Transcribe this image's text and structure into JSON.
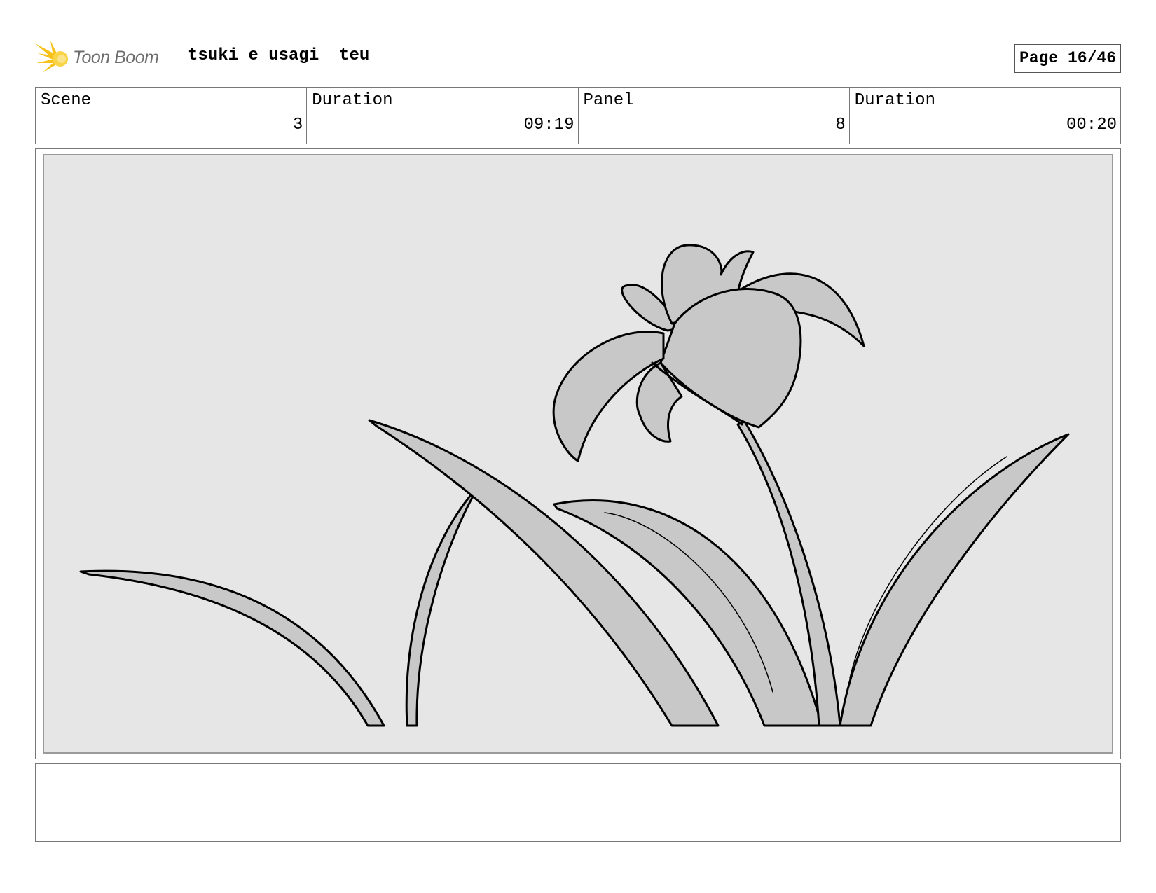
{
  "header": {
    "logo_text": "Toon Boom",
    "project_title": "tsuki e usagi  teu",
    "page_label": "Page 16/46"
  },
  "info": {
    "scene": {
      "label": "Scene",
      "value": "3"
    },
    "scene_duration": {
      "label": "Duration",
      "value": "09:19"
    },
    "panel": {
      "label": "Panel",
      "value": "8"
    },
    "panel_duration": {
      "label": "Duration",
      "value": "00:20"
    }
  },
  "notes": {
    "text": ""
  },
  "colors": {
    "logo_accent": "#f6c21a",
    "panel_background": "#e6e6e6",
    "drawing_fill": "#c8c8c8",
    "drawing_line": "#000000"
  }
}
